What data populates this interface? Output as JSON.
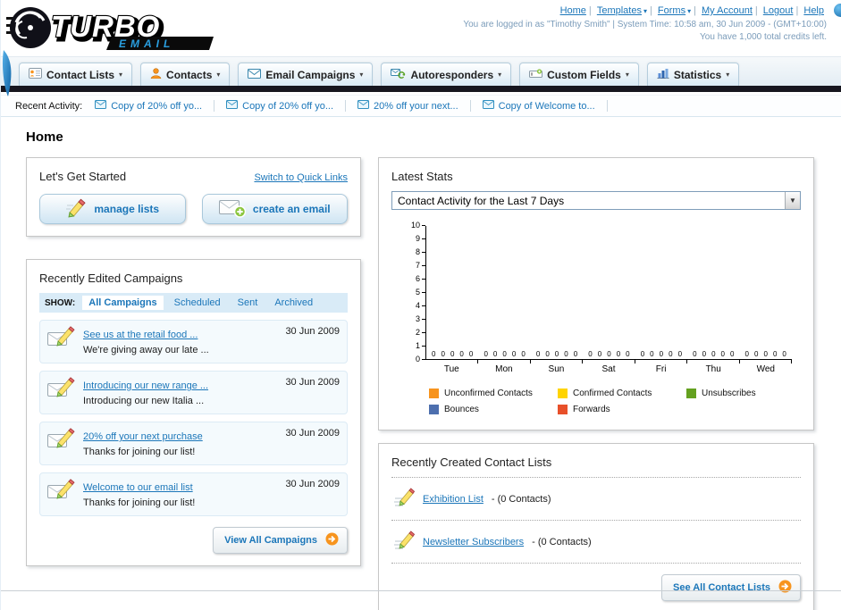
{
  "colors": {
    "accent_blue": "#1b76b9",
    "dark_bar": "#17161f",
    "orange": "#f7941e"
  },
  "logo": {
    "main": "TURBO",
    "sub": "EMAIL"
  },
  "top_nav": {
    "links": [
      {
        "label": "Home",
        "dropdown": false
      },
      {
        "label": "Templates",
        "dropdown": true
      },
      {
        "label": "Forms",
        "dropdown": true
      },
      {
        "label": "My Account",
        "dropdown": false
      },
      {
        "label": "Logout",
        "dropdown": false
      },
      {
        "label": "Help",
        "dropdown": false
      }
    ],
    "login_info": "You are logged in as \"Timothy Smith\" | System Time: 10:58 am, 30 Jun 2009 - (GMT+10:00)",
    "credits_info": "You have 1,000 total credits left."
  },
  "tabs": [
    {
      "label": "Contact Lists"
    },
    {
      "label": "Contacts"
    },
    {
      "label": "Email Campaigns"
    },
    {
      "label": "Autoresponders"
    },
    {
      "label": "Custom Fields"
    },
    {
      "label": "Statistics"
    }
  ],
  "recent_activity": {
    "label": "Recent Activity:",
    "items": [
      {
        "text": "Copy of 20% off yo..."
      },
      {
        "text": "Copy of 20% off yo..."
      },
      {
        "text": "20% off your next..."
      },
      {
        "text": "Copy of Welcome to..."
      }
    ]
  },
  "page": {
    "title": "Home"
  },
  "get_started": {
    "title": "Let's Get Started",
    "switch_link": "Switch to Quick Links",
    "manage_lists_label": "manage lists",
    "create_email_label": "create an email"
  },
  "campaigns": {
    "title": "Recently Edited Campaigns",
    "show_label": "SHOW:",
    "filters": [
      {
        "label": "All Campaigns",
        "active": true
      },
      {
        "label": "Scheduled",
        "active": false
      },
      {
        "label": "Sent",
        "active": false
      },
      {
        "label": "Archived",
        "active": false
      }
    ],
    "items": [
      {
        "title": "See us at the retail food ...",
        "subtitle": "We're giving away our late ...",
        "date": "30 Jun 2009"
      },
      {
        "title": "Introducing our new range ...",
        "subtitle": "Introducing our new Italia ...",
        "date": "30 Jun 2009"
      },
      {
        "title": "20% off your next purchase",
        "subtitle": "Thanks for joining our list!",
        "date": "30 Jun 2009"
      },
      {
        "title": "Welcome to our email list",
        "subtitle": "Thanks for joining our list!",
        "date": "30 Jun 2009"
      }
    ],
    "view_all_label": "View All Campaigns"
  },
  "stats": {
    "title": "Latest Stats",
    "activity_select": "Contact Activity for the Last 7 Days",
    "chart_data": {
      "type": "bar",
      "categories": [
        "Tue",
        "Mon",
        "Sun",
        "Sat",
        "Fri",
        "Thu",
        "Wed"
      ],
      "series": [
        {
          "name": "Unconfirmed Contacts",
          "color": "#f7941e",
          "values": [
            0,
            0,
            0,
            0,
            0,
            0,
            0
          ]
        },
        {
          "name": "Confirmed Contacts",
          "color": "#ffd400",
          "values": [
            0,
            0,
            0,
            0,
            0,
            0,
            0
          ]
        },
        {
          "name": "Unsubscribes",
          "color": "#64a120",
          "values": [
            0,
            0,
            0,
            0,
            0,
            0,
            0
          ]
        },
        {
          "name": "Bounces",
          "color": "#4d6fae",
          "values": [
            0,
            0,
            0,
            0,
            0,
            0,
            0
          ]
        },
        {
          "name": "Forwards",
          "color": "#e8502a",
          "values": [
            0,
            0,
            0,
            0,
            0,
            0,
            0
          ]
        }
      ],
      "ylim": [
        0,
        10
      ],
      "ytick_step": 1,
      "grid": false,
      "legend_position": "bottom",
      "show_value_labels": true
    }
  },
  "contact_lists": {
    "title": "Recently Created Contact Lists",
    "items": [
      {
        "name": "Exhibition List",
        "meta": "- (0 Contacts)"
      },
      {
        "name": "Newsletter Subscribers",
        "meta": "- (0 Contacts)"
      }
    ],
    "see_all_label": "See All Contact Lists"
  }
}
